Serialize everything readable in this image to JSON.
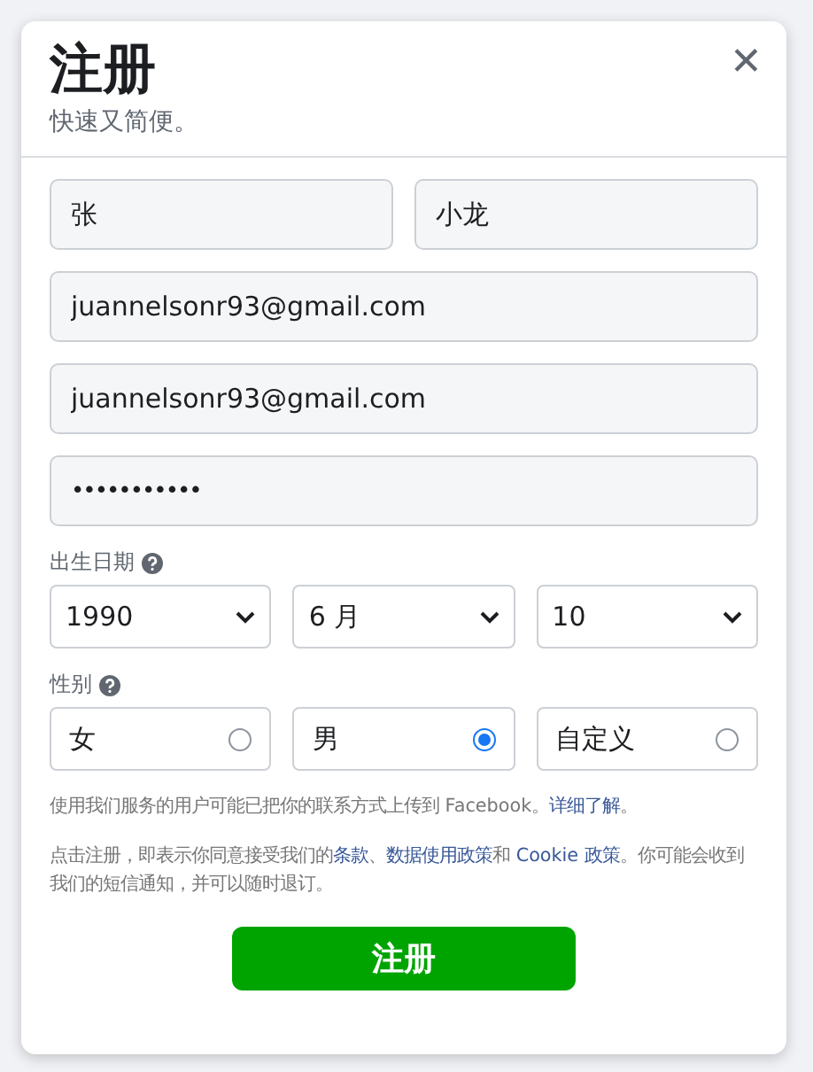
{
  "dialog": {
    "title": "注册",
    "subtitle": "快速又简便。",
    "close": "✕"
  },
  "name_fields": [
    {
      "value": "张"
    },
    {
      "value": "小龙"
    }
  ],
  "fields": [
    {
      "kind": "text",
      "value": "juannelsonr93@gmail.com"
    },
    {
      "kind": "text",
      "value": "juannelsonr93@gmail.com"
    },
    {
      "kind": "password",
      "value": "•••••••••••"
    }
  ],
  "birthday": {
    "label": "出生日期",
    "selects": [
      {
        "value": "1990"
      },
      {
        "value": "6 月"
      },
      {
        "value": "10"
      }
    ]
  },
  "gender": {
    "label": "性别",
    "options": [
      {
        "label": "女",
        "selected": false
      },
      {
        "label": "男",
        "selected": true
      },
      {
        "label": "自定义",
        "selected": false
      }
    ]
  },
  "notices": [
    [
      {
        "text": "使用我们服务的用户可能已把你的联系方式上传到 Facebook。",
        "link": false
      },
      {
        "text": "详细了解",
        "link": true
      },
      {
        "text": "。",
        "link": false
      }
    ],
    [
      {
        "text": "点击注册，即表示你同意接受我们的",
        "link": false
      },
      {
        "text": "条款",
        "link": true
      },
      {
        "text": "、",
        "link": false
      },
      {
        "text": "数据使用政策",
        "link": true
      },
      {
        "text": "和 ",
        "link": false
      },
      {
        "text": "Cookie 政策",
        "link": true
      },
      {
        "text": "。你可能会收到我们的短信通知，并可以随时退订。",
        "link": false
      }
    ]
  ],
  "submit": "注册"
}
